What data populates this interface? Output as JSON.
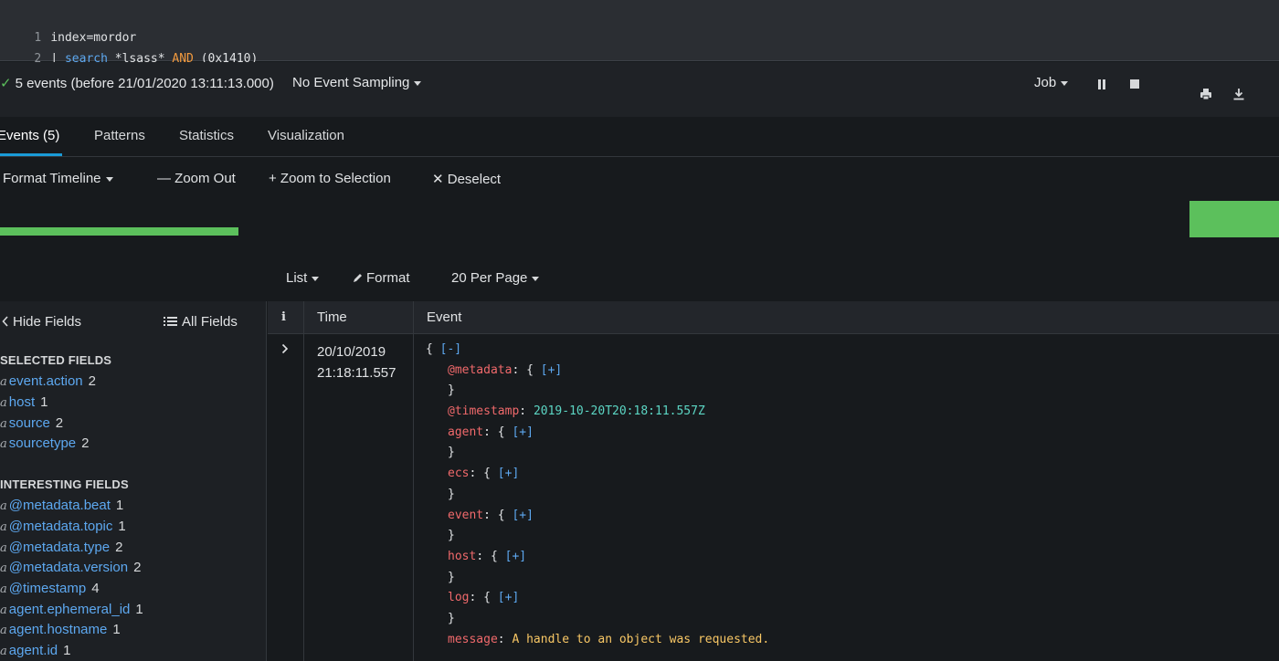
{
  "query": {
    "line1_num": "1",
    "line1": "index=mordor",
    "line2_num": "2",
    "line2_pipe": "| ",
    "line2_cmd": "search",
    "line2_term": " *lsass* ",
    "line2_op": "AND",
    "line2_rest": " (0x1410)"
  },
  "status": {
    "check": "✓",
    "event_count": "5 events (before 21/01/2020 13:11:13.000)",
    "sampling": "No Event Sampling",
    "job": "Job"
  },
  "tabs": [
    {
      "label": "Events (5)"
    },
    {
      "label": "Patterns"
    },
    {
      "label": "Statistics"
    },
    {
      "label": "Visualization"
    }
  ],
  "timeline_toolbar": {
    "format": "Format Timeline",
    "zoom_out": "— Zoom Out",
    "zoom_sel": "+ Zoom to Selection",
    "deselect": "✕ Deselect"
  },
  "results": {
    "list": "List",
    "format": "Format",
    "per_page": "20 Per Page"
  },
  "sidebar": {
    "hide": "Hide Fields",
    "all": "All Fields",
    "selected_title": "SELECTED FIELDS",
    "selected": [
      {
        "type": "a",
        "name": "event.action",
        "count": "2"
      },
      {
        "type": "a",
        "name": "host",
        "count": "1"
      },
      {
        "type": "a",
        "name": "source",
        "count": "2"
      },
      {
        "type": "a",
        "name": "sourcetype",
        "count": "2"
      }
    ],
    "interesting_title": "INTERESTING FIELDS",
    "interesting": [
      {
        "type": "a",
        "name": "@metadata.beat",
        "count": "1"
      },
      {
        "type": "a",
        "name": "@metadata.topic",
        "count": "1"
      },
      {
        "type": "a",
        "name": "@metadata.type",
        "count": "2"
      },
      {
        "type": "a",
        "name": "@metadata.version",
        "count": "2"
      },
      {
        "type": "a",
        "name": "@timestamp",
        "count": "4"
      },
      {
        "type": "a",
        "name": "agent.ephemeral_id",
        "count": "1"
      },
      {
        "type": "a",
        "name": "agent.hostname",
        "count": "1"
      },
      {
        "type": "a",
        "name": "agent.id",
        "count": "1"
      }
    ]
  },
  "table": {
    "col_info": "i",
    "col_time": "Time",
    "col_event": "Event",
    "row": {
      "date": "20/10/2019",
      "time": "21:18:11.557",
      "open": "{ ",
      "collapse": "[-]",
      "fields": [
        {
          "key": "@metadata",
          "sep": ": { ",
          "link": "[+]",
          "close": "}"
        },
        {
          "key": "@timestamp",
          "sep": ": ",
          "value": "2019-10-20T20:18:11.557Z"
        },
        {
          "key": "agent",
          "sep": ": { ",
          "link": "[+]",
          "close": "}"
        },
        {
          "key": "ecs",
          "sep": ": { ",
          "link": "[+]",
          "close": "}"
        },
        {
          "key": "event",
          "sep": ": { ",
          "link": "[+]",
          "close": "}"
        },
        {
          "key": "host",
          "sep": ": { ",
          "link": "[+]",
          "close": "}"
        },
        {
          "key": "log",
          "sep": ": { ",
          "link": "[+]",
          "close": "}"
        },
        {
          "key": "message",
          "sep": ": ",
          "msg": "A handle to an object was requested."
        }
      ]
    }
  }
}
